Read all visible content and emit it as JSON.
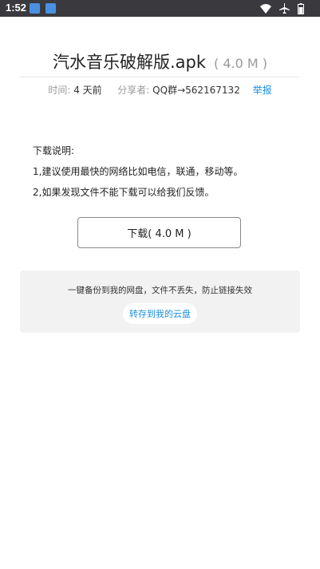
{
  "status_bar": {
    "time": "1:52",
    "icons": [
      "app-notification-icon",
      "app-notification-icon",
      "wifi-icon",
      "airplane-icon",
      "battery-icon"
    ]
  },
  "file": {
    "title": "汽水音乐破解版.apk",
    "size": "( 4.0 M )"
  },
  "meta": {
    "time_label": "时间:",
    "time_value": "4 天前",
    "sharer_label": "分享者:",
    "sharer_value": "QQ群→562167132",
    "report_label": "举报"
  },
  "description": {
    "heading": "下载说明:",
    "line1": "1,建议使用最快的网络比如电信，联通，移动等。",
    "line2": "2,如果发现文件不能下载可以给我们反馈。"
  },
  "download": {
    "label": "下载( 4.0 M )"
  },
  "cloud": {
    "text": "一键备份到我的网盘，文件不丢失，防止链接失效",
    "button_label": "转存到我的云盘"
  },
  "colors": {
    "accent": "#1a8fe0",
    "status_bar": "#3a3a3e"
  }
}
